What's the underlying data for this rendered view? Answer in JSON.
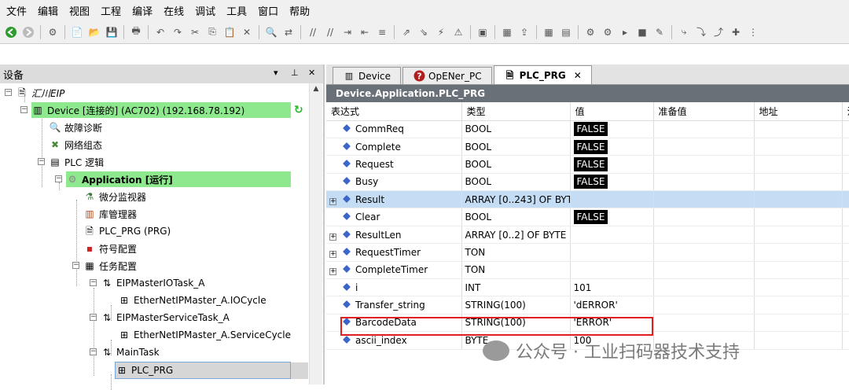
{
  "menu": [
    "文件",
    "编辑",
    "视图",
    "工程",
    "编译",
    "在线",
    "调试",
    "工具",
    "窗口",
    "帮助"
  ],
  "devices_panel": {
    "title": "设备"
  },
  "tree": {
    "root": "汇川EIP",
    "device": "Device [连接的] (AC702) (192.168.78.192)",
    "diag": "故障诊断",
    "network": "网络组态",
    "plc": "PLC 逻辑",
    "app": "Application [运行]",
    "monitor": "微分监视器",
    "lib": "库管理器",
    "prg": "PLC_PRG (PRG)",
    "symbol": "符号配置",
    "task_cfg": "任务配置",
    "task1": "EIPMasterIOTask_A",
    "task1_call": "EtherNetIPMaster_A.IOCycle",
    "task2": "EIPMasterServiceTask_A",
    "task2_call": "EtherNetIPMaster_A.ServiceCycle",
    "task3": "MainTask",
    "task3_call": "PLC_PRG"
  },
  "tabs": [
    "Device",
    "OpENer_PC",
    "PLC_PRG"
  ],
  "path": "Device.Application.PLC_PRG",
  "columns": [
    "表达式",
    "类型",
    "值",
    "准备值",
    "地址",
    "注"
  ],
  "rows": [
    {
      "expr": "CommReq",
      "type": "BOOL",
      "value": "FALSE",
      "false": true,
      "exp": false
    },
    {
      "expr": "Complete",
      "type": "BOOL",
      "value": "FALSE",
      "false": true,
      "exp": false
    },
    {
      "expr": "Request",
      "type": "BOOL",
      "value": "FALSE",
      "false": true,
      "exp": false
    },
    {
      "expr": "Busy",
      "type": "BOOL",
      "value": "FALSE",
      "false": true,
      "exp": false
    },
    {
      "expr": "Result",
      "type": "ARRAY [0..243] OF BYTE",
      "value": "",
      "false": false,
      "exp": true,
      "selected": true
    },
    {
      "expr": "Clear",
      "type": "BOOL",
      "value": "FALSE",
      "false": true,
      "exp": false
    },
    {
      "expr": "ResultLen",
      "type": "ARRAY [0..2] OF BYTE",
      "value": "",
      "false": false,
      "exp": true
    },
    {
      "expr": "RequestTimer",
      "type": "TON",
      "value": "",
      "false": false,
      "exp": true
    },
    {
      "expr": "CompleteTimer",
      "type": "TON",
      "value": "",
      "false": false,
      "exp": true
    },
    {
      "expr": "i",
      "type": "INT",
      "value": "101",
      "false": false,
      "exp": false
    },
    {
      "expr": "Transfer_string",
      "type": "STRING(100)",
      "value": "'dERROR'",
      "false": false,
      "exp": false
    },
    {
      "expr": "BarcodeData",
      "type": "STRING(100)",
      "value": "'ERROR'",
      "false": false,
      "exp": false
    },
    {
      "expr": "ascii_index",
      "type": "BYTE",
      "value": "100",
      "false": false,
      "exp": false
    }
  ],
  "watermark": "公众号 · 工业扫码器技术支持"
}
